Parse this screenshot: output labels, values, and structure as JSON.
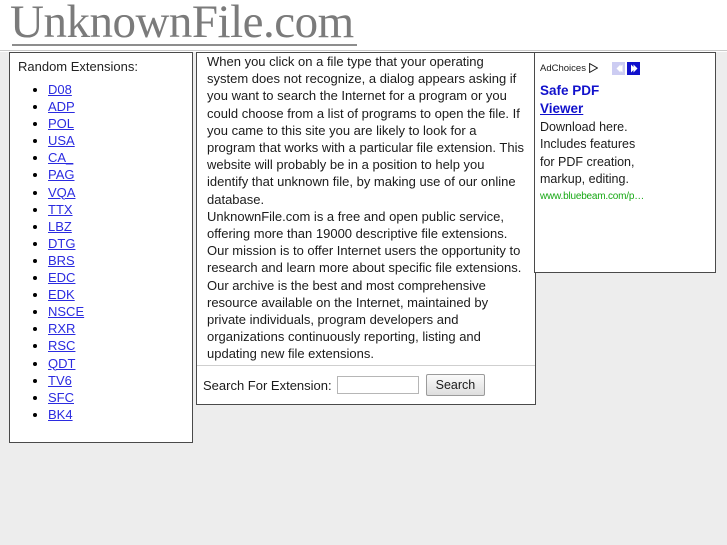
{
  "site": {
    "logo_text": "UnknownFile.com"
  },
  "sidebar": {
    "title": "Random Extensions:",
    "items": [
      {
        "label": "D08"
      },
      {
        "label": "ADP"
      },
      {
        "label": "POL"
      },
      {
        "label": "USA"
      },
      {
        "label": "CA_"
      },
      {
        "label": "PAG"
      },
      {
        "label": "VQA"
      },
      {
        "label": "TTX"
      },
      {
        "label": "LBZ"
      },
      {
        "label": "DTG"
      },
      {
        "label": "BRS"
      },
      {
        "label": "EDC"
      },
      {
        "label": "EDK"
      },
      {
        "label": "NSCE"
      },
      {
        "label": "RXR"
      },
      {
        "label": "RSC"
      },
      {
        "label": "QDT"
      },
      {
        "label": "TV6"
      },
      {
        "label": "SFC"
      },
      {
        "label": "BK4"
      }
    ]
  },
  "main": {
    "intro_paragraph": "When you click on a file type that your operating system does not recognize, a dialog appears asking if you want to search the Internet for a program or you could choose from a list of programs to open the file. If you came to this site you are likely to look for a program that works with a particular file extension. This website will probably be in a position to help you identify that unknown file, by making use of our online database.",
    "about_paragraph": "UnknownFile.com is a free and open public service, offering more than 19000 descriptive file extensions. Our mission is to offer Internet users the opportunity to research and learn more about specific file extensions. Our archive is the best and most comprehensive resource available on the Internet, maintained by private individuals, program developers and organizations continuously reporting, listing and updating new file extensions.",
    "search": {
      "label": "Search For Extension:",
      "value": "",
      "placeholder": "",
      "button_label": "Search"
    }
  },
  "ad": {
    "adchoices_label": "AdChoices",
    "adchoices_icon": "triangle-right-icon",
    "prev_icon": "chevron-left-icon",
    "next_icon": "chevron-right-icon",
    "headline_line1": "Safe PDF",
    "headline_line2": "Viewer",
    "description": "Download here. Includes features for PDF creation, markup, editing.",
    "display_url": "www.bluebeam.com/p…"
  },
  "colors": {
    "page_background": "#ededed",
    "panel_background": "#ffffff",
    "panel_border": "#4a4a4a",
    "link": "#2b2be0",
    "ad_link": "#1111cc",
    "ad_url": "#17a814",
    "logo": "#7b7b7b"
  }
}
